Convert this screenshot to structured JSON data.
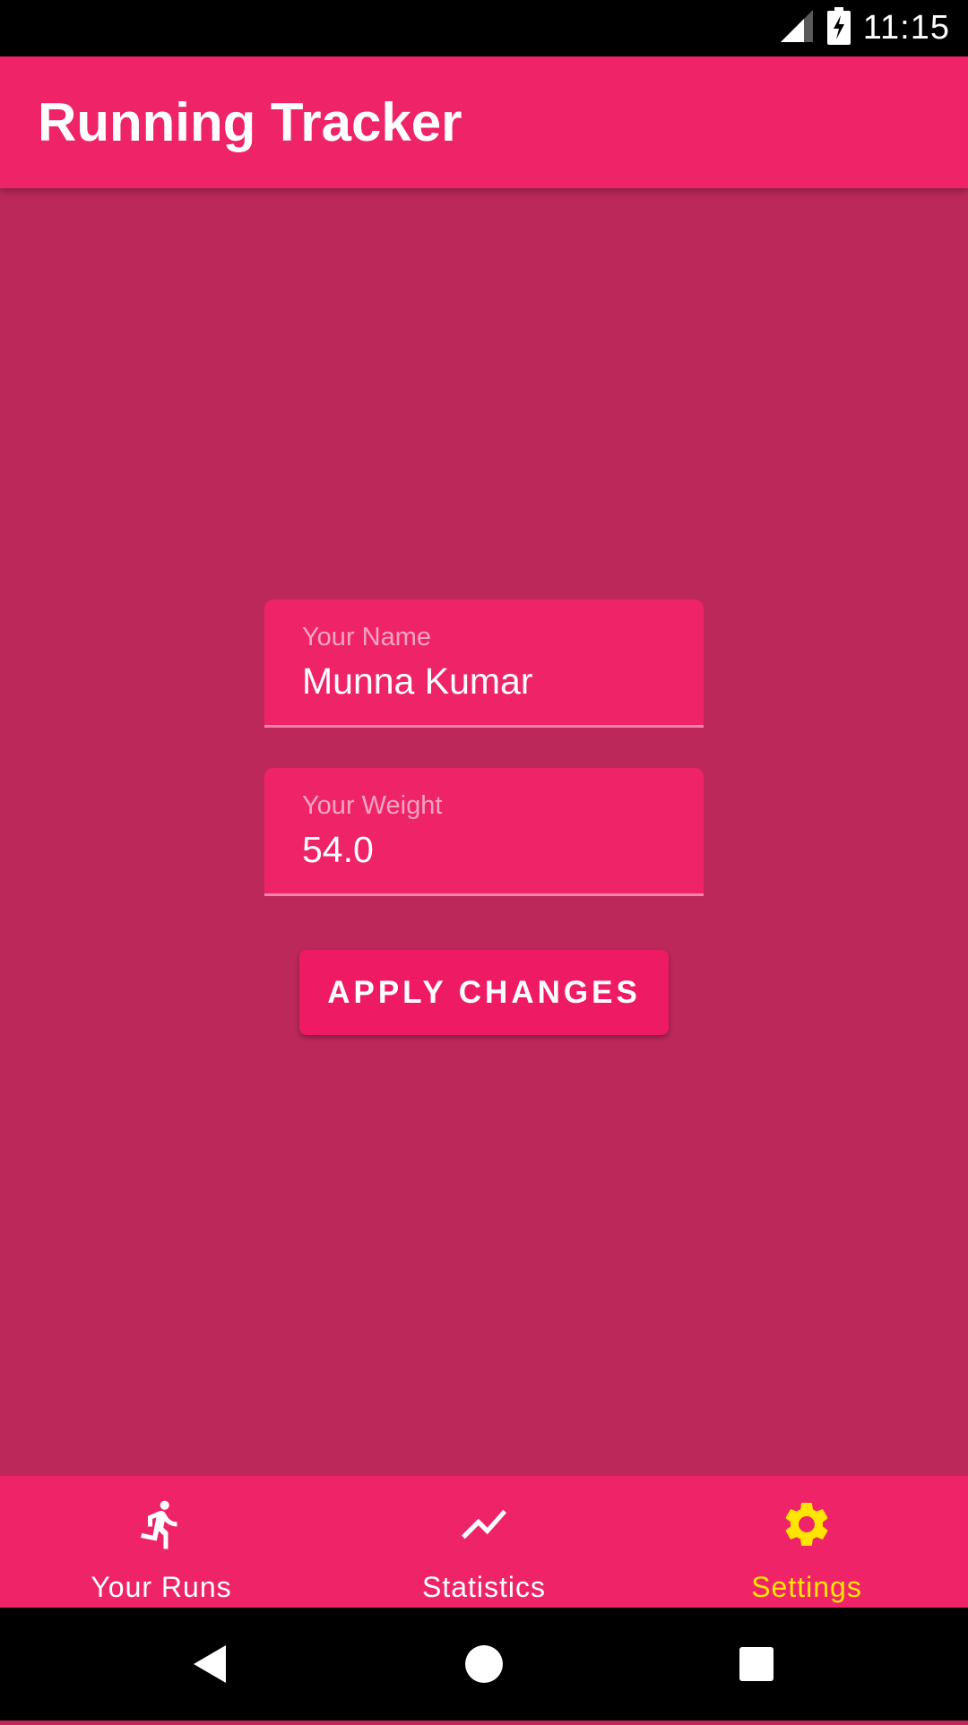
{
  "status_bar": {
    "time": "11:15",
    "icons": [
      "signal-icon",
      "battery-charging-icon"
    ]
  },
  "app_bar": {
    "title": "Running Tracker"
  },
  "form": {
    "name": {
      "label": "Your Name",
      "value": "Munna Kumar"
    },
    "weight": {
      "label": "Your Weight",
      "value": "54.0"
    },
    "apply_label": "APPLY CHANGES"
  },
  "bottom_nav": {
    "items": [
      {
        "label": "Your Runs",
        "icon": "running-person-icon",
        "selected": false
      },
      {
        "label": "Statistics",
        "icon": "trending-line-icon",
        "selected": false
      },
      {
        "label": "Settings",
        "icon": "gear-icon",
        "selected": true
      }
    ]
  },
  "system_nav": {
    "icons": [
      "back-icon",
      "home-icon",
      "recents-icon"
    ]
  },
  "colors": {
    "background": "#BC285A",
    "primary": "#EF2468",
    "accent_button": "#EE1B64",
    "selected_nav": "#FFE500",
    "unselected_nav": "#FFFFFF",
    "field_label": "#F5A5C0"
  }
}
